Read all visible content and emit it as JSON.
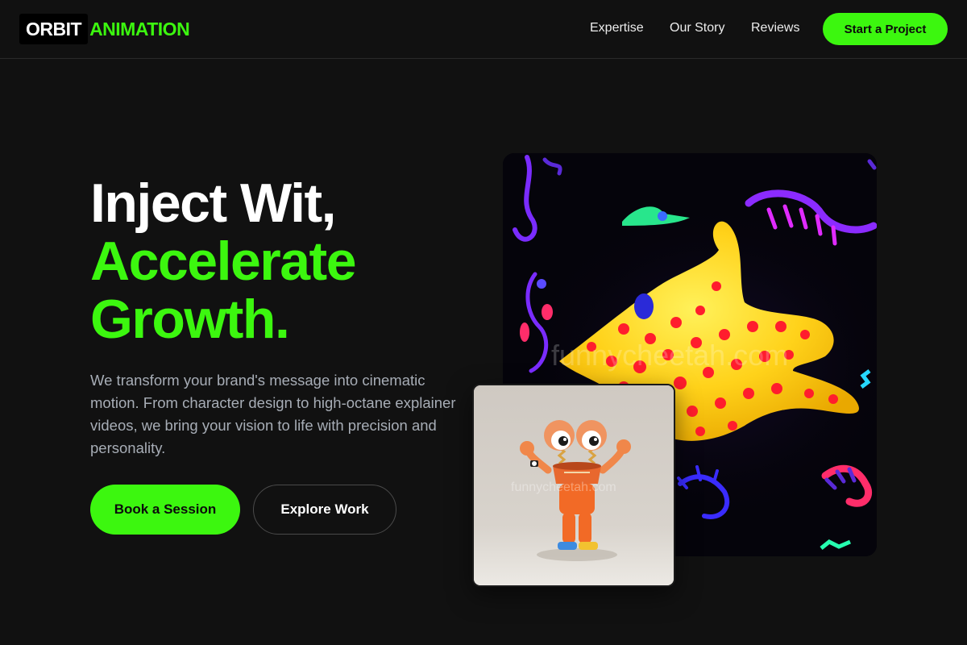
{
  "header": {
    "logo": {
      "word1": "ORBIT",
      "word2": "ANIMATION"
    },
    "nav": [
      {
        "label": "Expertise"
      },
      {
        "label": "Our Story"
      },
      {
        "label": "Reviews"
      }
    ],
    "cta_label": "Start a Project"
  },
  "hero": {
    "headline_line1": "Inject Wit,",
    "headline_line2": "Accelerate",
    "headline_line3": "Growth.",
    "subtext": "We transform your brand's message into cinematic motion. From character design to high-octane explainer videos, we bring your vision to life with precision and personality.",
    "primary_button": "Book a Session",
    "secondary_button": "Explore Work"
  },
  "images": {
    "main_watermark": "funnycheetah.com",
    "small_watermark": "funnycheetah.com"
  },
  "colors": {
    "background": "#111111",
    "accent": "#3cf70f",
    "body_text": "#a7adb6"
  },
  "icons": {
    "main_image": "yellow-polka-dot-creature-illustration",
    "small_image": "orange-cartoon-character-illustration"
  }
}
